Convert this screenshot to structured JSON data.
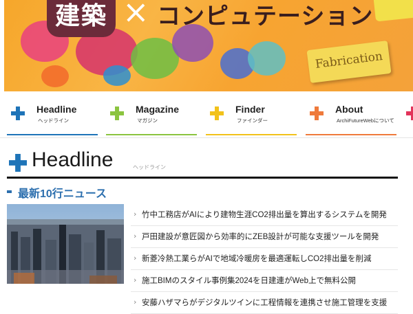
{
  "banner": {
    "title_kanji": "建築",
    "title_x": "×",
    "title_rest": "コンピュテーション",
    "tag": "Fabrication"
  },
  "nav": {
    "items": [
      {
        "label": "Headline",
        "sub": "ヘッドライン",
        "color": "#1e74b8"
      },
      {
        "label": "Magazine",
        "sub": "マガジン",
        "color": "#8bc43f"
      },
      {
        "label": "Finder",
        "sub": "ファインダー",
        "color": "#f2c21a"
      },
      {
        "label": "About",
        "sub": "ArchiFutureWebについて",
        "color": "#ef7a3b"
      }
    ]
  },
  "page": {
    "title": "Headline",
    "title_kana": "ヘッドライン"
  },
  "section": {
    "title": "最新10行ニュース",
    "news": [
      "竹中工務店がAIにより建物生涯CO2排出量を算出するシステムを開発",
      "戸田建設が意匠図から効率的にZEB設計が可能な支援ツールを開発",
      "新菱冷熱工業らがAIで地域冷暖房を最適運転しCO2排出量を削減",
      "施工BIMのスタイル事例集2024を日建連がWeb上で無料公開",
      "安藤ハザマらがデジタルツインに工程情報を連携させ施工管理を支援"
    ]
  },
  "colors": {
    "accent_blue": "#2c6fae",
    "banner_orange": "#f6a62a"
  }
}
